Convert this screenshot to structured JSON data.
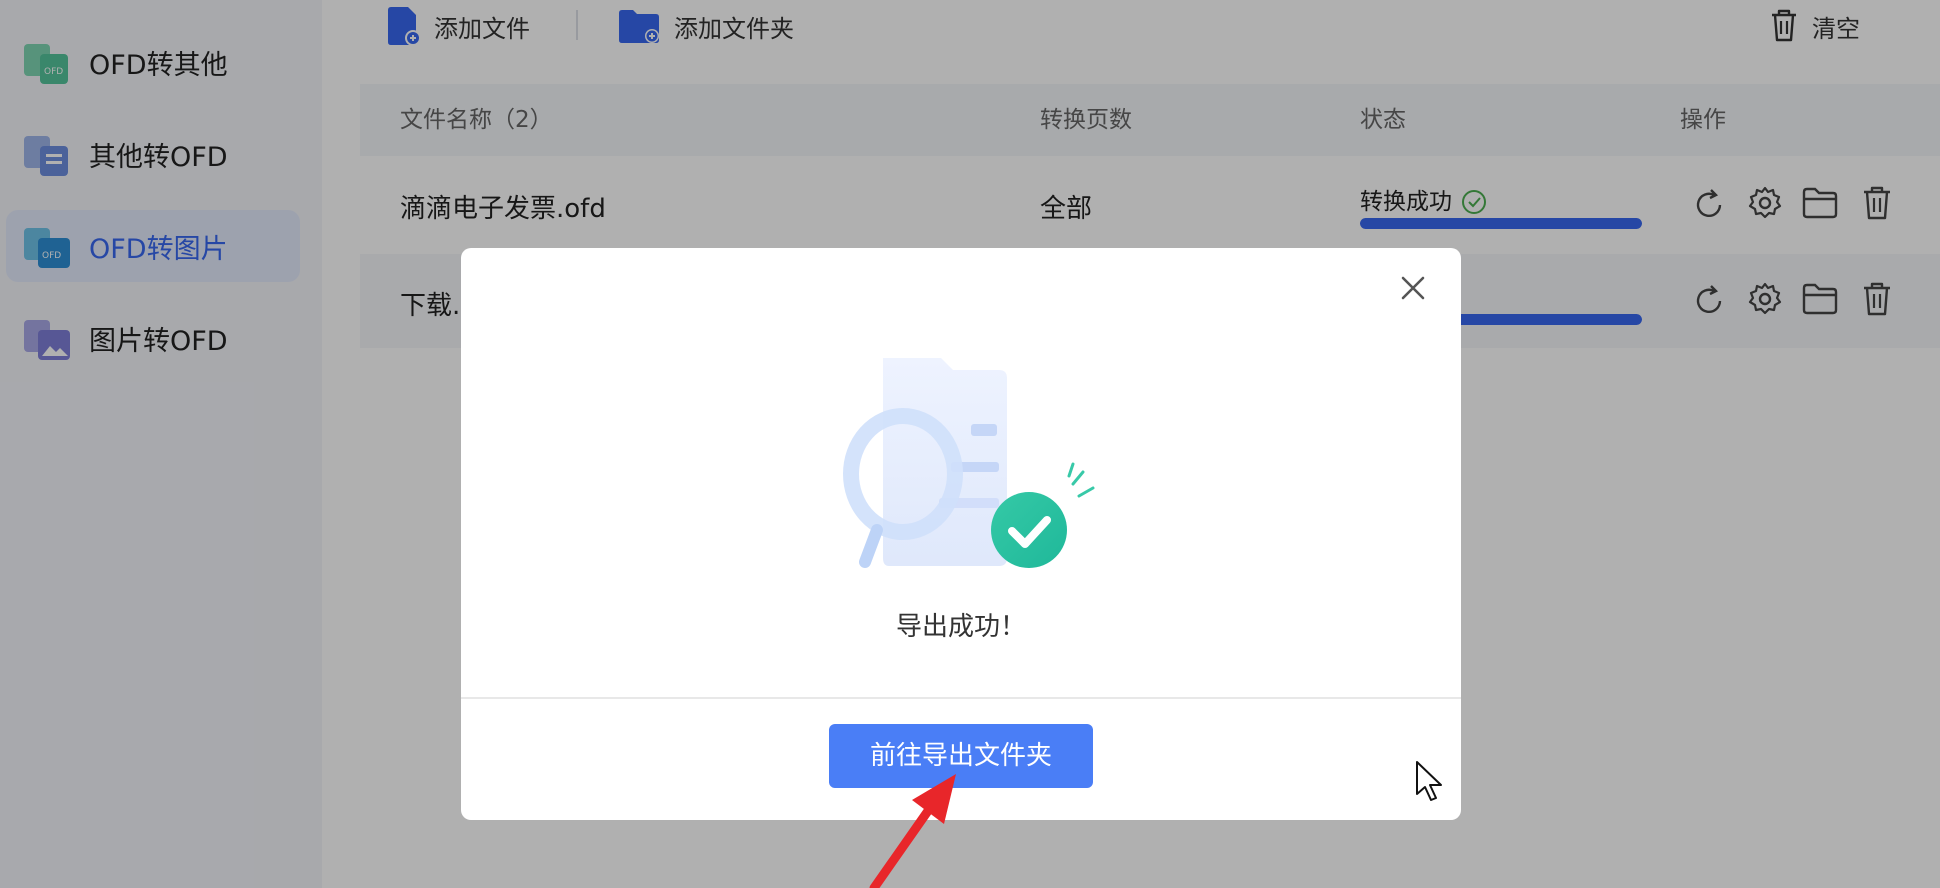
{
  "sidebar": {
    "items": [
      {
        "label": "OFD转其他",
        "icon": "ofd-to-other-icon",
        "active": false
      },
      {
        "label": "其他转OFD",
        "icon": "other-to-ofd-icon",
        "active": false
      },
      {
        "label": "OFD转图片",
        "icon": "ofd-to-image-icon",
        "active": true
      },
      {
        "label": "图片转OFD",
        "icon": "image-to-ofd-icon",
        "active": false
      }
    ]
  },
  "toolbar": {
    "add_file_label": "添加文件",
    "add_folder_label": "添加文件夹",
    "clear_label": "清空"
  },
  "table": {
    "columns": [
      "文件名称（2）",
      "转换页数",
      "状态",
      "操作"
    ],
    "rows": [
      {
        "name": "滴滴电子发票.ofd",
        "pages": "全部",
        "status": "转换成功",
        "progress": 1.0
      },
      {
        "name": "下载.",
        "pages": "",
        "status": "",
        "progress": 1.0
      }
    ]
  },
  "modal": {
    "message": "导出成功！",
    "button_label": "前往导出文件夹"
  },
  "colors": {
    "accent": "#3868f0",
    "button": "#4a7ef6",
    "success": "#2fc3a0",
    "annotation_arrow": "#e8262a"
  }
}
